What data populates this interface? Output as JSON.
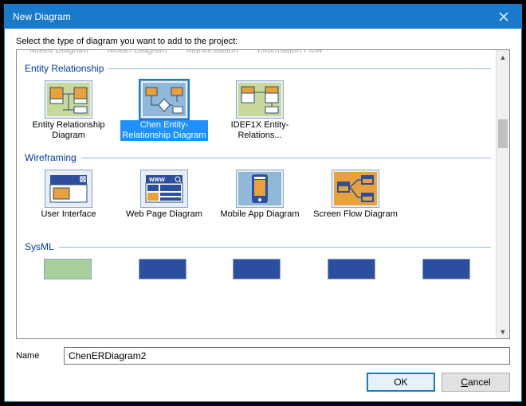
{
  "window": {
    "title": "New Diagram"
  },
  "instruction": "Select the type of diagram you want to add to the project:",
  "cutrow": [
    "Mixed Diagram",
    "Model Diagram",
    "Manifestation",
    "Information Flow"
  ],
  "sections": {
    "er": {
      "title": "Entity Relationship",
      "items": [
        {
          "label": "Entity Relationship Diagram"
        },
        {
          "label": "Chen Entity-Relationship Diagram",
          "selected": true
        },
        {
          "label": "IDEF1X Entity-Relations..."
        }
      ]
    },
    "wf": {
      "title": "Wireframing",
      "items": [
        {
          "label": "User Interface"
        },
        {
          "label": "Web Page Diagram"
        },
        {
          "label": "Mobile App Diagram"
        },
        {
          "label": "Screen Flow Diagram"
        }
      ]
    },
    "sysml": {
      "title": "SysML"
    }
  },
  "name": {
    "label": "Name",
    "value": "ChenERDiagram2"
  },
  "buttons": {
    "ok": "OK",
    "cancel_pre": "",
    "cancel_u": "C",
    "cancel_post": "ancel"
  }
}
